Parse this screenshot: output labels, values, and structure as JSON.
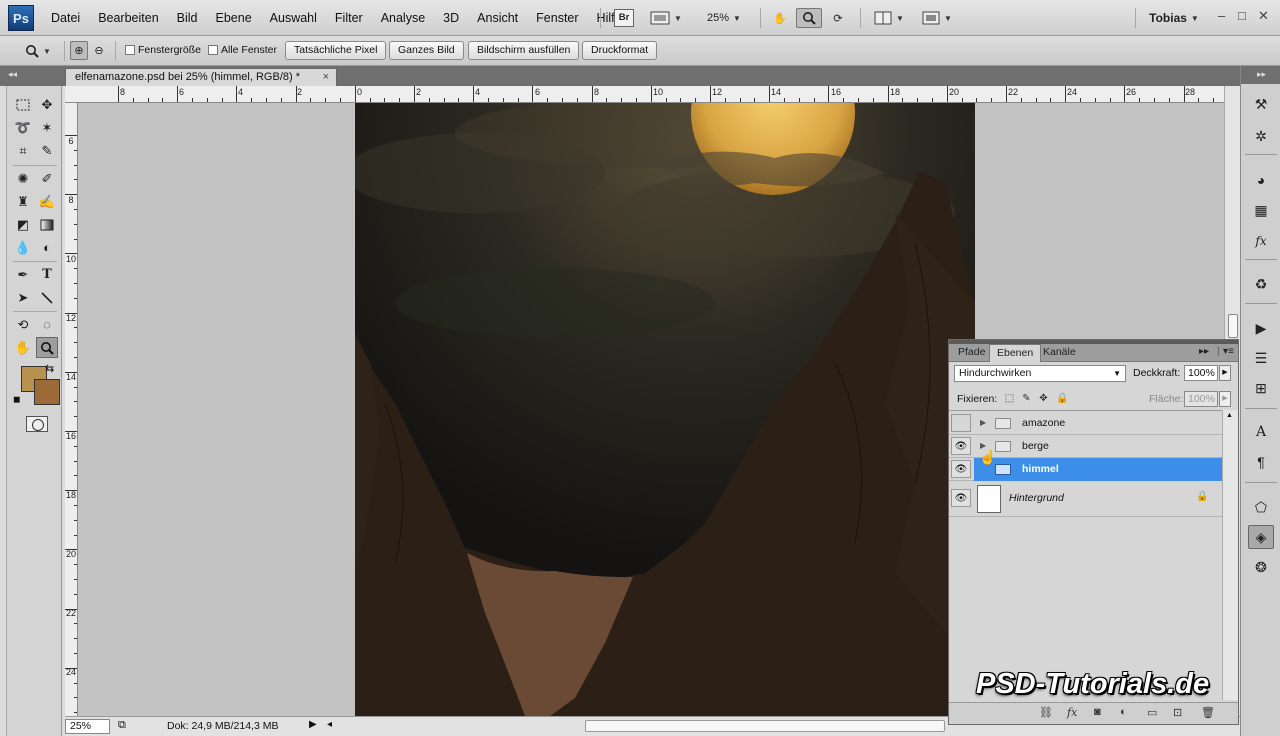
{
  "app": {
    "logo": "Ps",
    "menu": [
      "Datei",
      "Bearbeiten",
      "Bild",
      "Ebene",
      "Auswahl",
      "Filter",
      "Analyse",
      "3D",
      "Ansicht",
      "Fenster",
      "Hilfe"
    ],
    "bridge_label": "Br",
    "zoom": "25%",
    "user": "Tobias"
  },
  "options": {
    "fenstergroesse": "Fenstergröße",
    "alle_fenster": "Alle Fenster",
    "btn_actual": "Tatsächliche Pixel",
    "btn_fit": "Ganzes Bild",
    "btn_fill": "Bildschirm ausfüllen",
    "btn_print": "Druckformat"
  },
  "document": {
    "tab_title": "elfenamazone.psd bei 25% (himmel, RGB/8) *",
    "tab_close": "×",
    "ruler_top": [
      "8",
      "6",
      "4",
      "2",
      "0",
      "2",
      "4",
      "6",
      "8",
      "10",
      "12",
      "14",
      "16",
      "18",
      "20",
      "22",
      "24",
      "26",
      "28"
    ],
    "ruler_left": [
      "6",
      "8",
      "10",
      "12",
      "14",
      "16",
      "18",
      "20",
      "22",
      "24"
    ]
  },
  "status": {
    "zoom": "25%",
    "doc_info": "Dok: 24,9 MB/214,3 MB"
  },
  "layers_panel": {
    "tabs": [
      "Pfade",
      "Ebenen",
      "Kanäle"
    ],
    "blend_mode": "Hindurchwirken",
    "opacity_label": "Deckkraft:",
    "opacity_value": "100%",
    "lock_label": "Fixieren:",
    "fill_label": "Fläche:",
    "fill_value": "100%",
    "layers": [
      {
        "name": "amazone",
        "visible": false,
        "type": "group",
        "selected": false
      },
      {
        "name": "berge",
        "visible": true,
        "type": "group",
        "selected": false
      },
      {
        "name": "himmel",
        "visible": true,
        "type": "group",
        "selected": true
      },
      {
        "name": "Hintergrund",
        "visible": true,
        "type": "background",
        "selected": false
      }
    ]
  },
  "watermark": "PSD-Tutorials.de",
  "colors": {
    "foreground": "#b8914f",
    "background": "#9c6a37",
    "selection": "#3d8ee8"
  }
}
